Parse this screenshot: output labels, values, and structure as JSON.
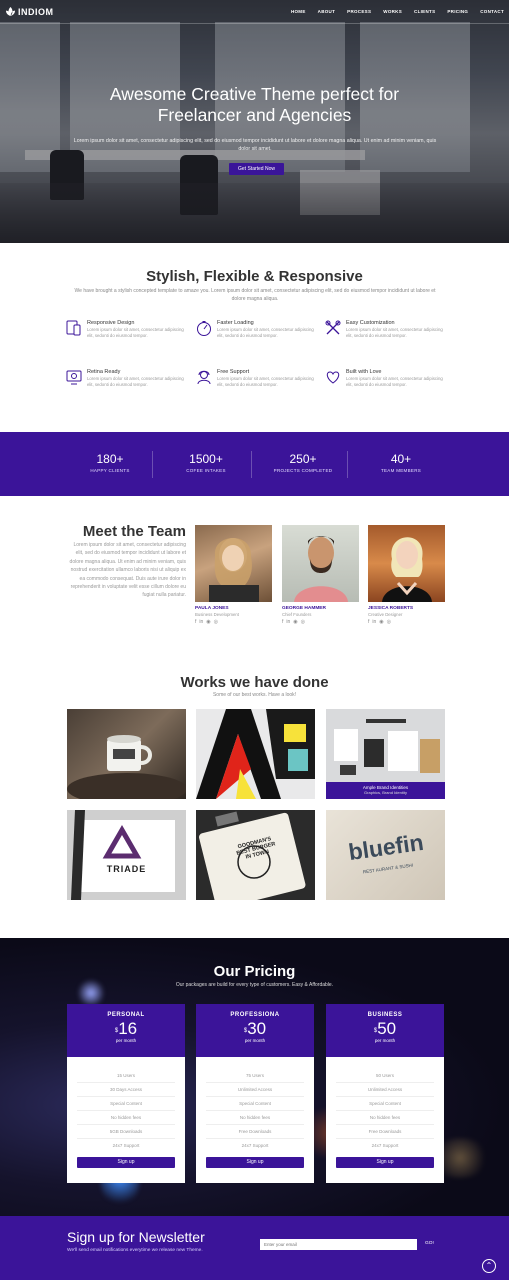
{
  "nav": {
    "brand": "INDIOM",
    "items": [
      "HOME",
      "ABOUT",
      "PROCESS",
      "WORKS",
      "CLIENTS",
      "PRICING",
      "CONTACT"
    ]
  },
  "hero": {
    "title_line1": "Awesome Creative Theme perfect for",
    "title_line2": "Freelancer and Agencies",
    "subtitle": "Lorem ipsum dolor sit amet, consectetur adipiscing elit, sed do eiusmod tempor incididunt ut labore et dolore magna aliqua. Ut enim ad minim veniam, quis dolor sit amet.",
    "cta": "Get Started Now"
  },
  "features": {
    "title": "Stylish, Flexible & Responsive",
    "subtitle": "We have brought a stylish concepted template to amaze you. Lorem ipsum dolor sit amet, consectetur adipiscing elit, sed do eiusmod tempor incididunt ut labore et dolore magna aliqua.",
    "items": [
      {
        "icon": "responsive-icon",
        "title": "Responsive Design",
        "text": "Lorem ipsum dolor sit amet, consectetur adipiscing elit, sedonti do eiusmod tempor."
      },
      {
        "icon": "speedometer-icon",
        "title": "Faster Loading",
        "text": "Lorem ipsum dolor sit amet, consectetur adipiscing elit, sedonti do eiusmod tempor."
      },
      {
        "icon": "tools-icon",
        "title": "Easy Customization",
        "text": "Lorem ipsum dolor sit amet, consectetur adipiscing elit, sedonti do eiusmod tempor."
      },
      {
        "icon": "monitor-icon",
        "title": "Retina Ready",
        "text": "Lorem ipsum dolor sit amet, consectetur adipiscing elit, sedonti do eiusmod tempor."
      },
      {
        "icon": "support-icon",
        "title": "Free Support",
        "text": "Lorem ipsum dolor sit amet, consectetur adipiscing elit, sedonti do eiusmod tempor."
      },
      {
        "icon": "heart-icon",
        "title": "Built with Love",
        "text": "Lorem ipsum dolor sit amet, consectetur adipiscing elit, sedonti do eiusmod tempor."
      }
    ],
    "accent": "#3b1499"
  },
  "stats": [
    {
      "number": "180+",
      "label": "HAPPY CLIENTS"
    },
    {
      "number": "1500+",
      "label": "COFEE INTAKES"
    },
    {
      "number": "250+",
      "label": "PROJECTS COMPLETED"
    },
    {
      "number": "40+",
      "label": "TEAM MEMBERS"
    }
  ],
  "team": {
    "title": "Meet the Team",
    "text": "Lorem ipsum dolor sit amet, consectetur adipiscing elit, sed do eiusmod tempor incididunt ut labore et dolore magna aliqua. Ut enim ad minim veniam, quis nostrud exercitation ullamco laboris nisi ut aliquip ex ea commodo consequat. Duis aute irure dolor in reprehenderit in voluptate velit esse cillum dolore eu fugiat nulla pariatur.",
    "members": [
      {
        "name": "PAULA JONES",
        "role": "Business Development"
      },
      {
        "name": "GEORGE HAMMER",
        "role": "Chief Founders"
      },
      {
        "name": "JESSICA ROBERTS",
        "role": "Creative Designer"
      }
    ],
    "social_icons": [
      "facebook-icon",
      "linkedin-icon",
      "github-icon",
      "dribbble-icon"
    ]
  },
  "works": {
    "title": "Works we have done",
    "subtitle": "Some of our best works. Have a look!",
    "items": [
      {
        "label": "mug"
      },
      {
        "label": "ab"
      },
      {
        "label": "stationery",
        "caption_title": "Ample Brand Identities",
        "caption_sub": "Graphics, Brand Identity"
      },
      {
        "label": "TRIADE"
      },
      {
        "label": "GOODMAN'S"
      },
      {
        "label": "bluefin"
      }
    ],
    "triade_text": "TRIADE",
    "goodman_line1": "GOODMAN'S",
    "goodman_line2": "BEST BURGER",
    "goodman_line3": "IN TOWN",
    "bluefin_text": "bluefin",
    "bluefin_sub": "REST AURANT & SUSHI"
  },
  "pricing": {
    "title": "Our Pricing",
    "subtitle": "Our packages are build for every type of customers. Easy & Affordable.",
    "plans": [
      {
        "name": "PERSONAL",
        "currency": "$",
        "price": "16",
        "period": "per month",
        "features": [
          "15 Users",
          "30 Days Access",
          "Special Content",
          "No hidden fees",
          "5GB Downloads",
          "24x7 Support"
        ],
        "button": "Sign up"
      },
      {
        "name": "PROFESSIONA",
        "currency": "$",
        "price": "30",
        "period": "per month",
        "features": [
          "75 Users",
          "Unlimited Access",
          "Special Content",
          "No hidden fees",
          "Free Downloads",
          "24x7 Support"
        ],
        "button": "Sign up"
      },
      {
        "name": "BUSINESS",
        "currency": "$",
        "price": "50",
        "period": "per month",
        "features": [
          "50 Users",
          "Unlimited Access",
          "Special Content",
          "No hidden fees",
          "Free Downloads",
          "24x7 Support"
        ],
        "button": "Sign up"
      }
    ]
  },
  "newsletter": {
    "title": "Sign up for Newsletter",
    "text": "We'll send email notifications everytime we release new Theme.",
    "placeholder": "Enter your email",
    "button": "GO!"
  }
}
